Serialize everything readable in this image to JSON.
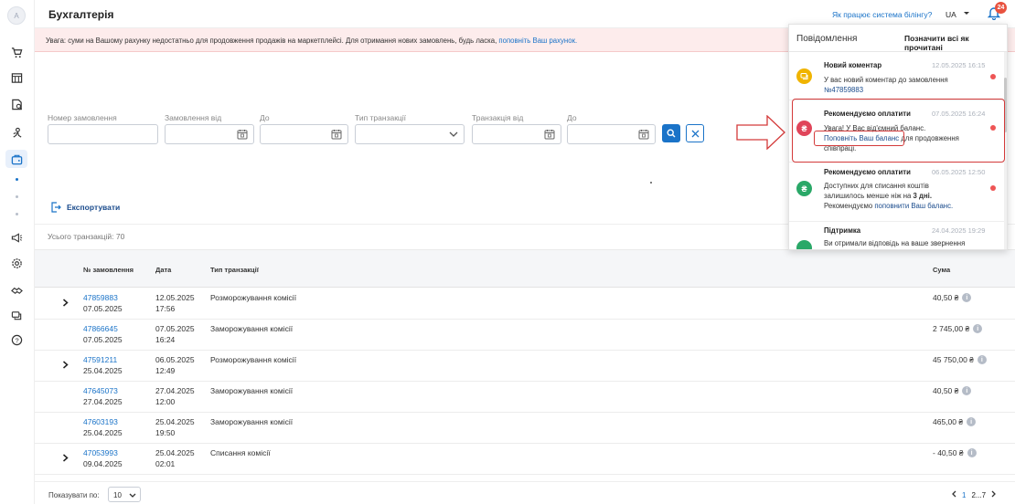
{
  "sidebar": {
    "avatar_letter": "A",
    "icons": [
      "cart-icon",
      "catalog-icon",
      "orders-icon",
      "users-icon",
      "accounting-icon",
      "megaphone-icon",
      "settings-icon",
      "handshake-icon",
      "messages-icon",
      "help-icon"
    ]
  },
  "header": {
    "title": "Бухгалтерія",
    "billing_link": "Як працює система білінгу?",
    "lang": "UA",
    "notif_count": "24"
  },
  "alert": {
    "text": "Увага: суми на Вашому рахунку недостатньо для продовження продажів на маркетплейсі. Для отримання нових замовлень, будь ласка, ",
    "link": "поповніть Ваш рахунок."
  },
  "filters": {
    "order_number": "Номер замовлення",
    "order_from": "Замовлення від",
    "order_to": "До",
    "tx_type": "Тип транзакції",
    "tx_from": "Транзакція від",
    "tx_to": "До"
  },
  "actions": {
    "export": "Експортувати"
  },
  "total": "Усього транзакцій: 70",
  "table": {
    "columns": {
      "order": "№ замовлення",
      "date": "Дата",
      "type": "Тип транзакції",
      "sum": "Сума"
    },
    "rows": [
      {
        "order": "47859883",
        "order_date": "07.05.2025",
        "date": "12.05.2025",
        "time": "17:56",
        "type": "Розморожування комісії",
        "sum": "40,50 ₴",
        "expandable": true
      },
      {
        "order": "47866645",
        "order_date": "07.05.2025",
        "date": "07.05.2025",
        "time": "16:24",
        "type": "Заморожування комісії",
        "sum": "2 745,00 ₴",
        "expandable": false
      },
      {
        "order": "47591211",
        "order_date": "25.04.2025",
        "date": "06.05.2025",
        "time": "12:49",
        "type": "Розморожування комісії",
        "sum": "45 750,00 ₴",
        "expandable": true
      },
      {
        "order": "47645073",
        "order_date": "27.04.2025",
        "date": "27.04.2025",
        "time": "12:00",
        "type": "Заморожування комісії",
        "sum": "40,50 ₴",
        "expandable": false
      },
      {
        "order": "47603193",
        "order_date": "25.04.2025",
        "date": "25.04.2025",
        "time": "19:50",
        "type": "Заморожування комісії",
        "sum": "465,00 ₴",
        "expandable": false
      },
      {
        "order": "47053993",
        "order_date": "09.04.2025",
        "date": "25.04.2025",
        "time": "02:01",
        "type": "Списання комісії",
        "sum": "- 40,50 ₴",
        "expandable": true
      }
    ]
  },
  "footer": {
    "per_page_label": "Показувати по:",
    "per_page_value": "10",
    "page_current": "1",
    "page_rest": "2...7"
  },
  "notifications": {
    "title": "Повідомлення",
    "mark_all": "Позначити всі як прочитані",
    "items": [
      {
        "title": "Новий коментар",
        "time": "12.05.2025 16:15",
        "text": "У вас новий коментар до замовлення",
        "link": "№47859883",
        "color": "#f0b400"
      },
      {
        "title": "Рекомендуємо оплатити",
        "time": "07.05.2025 16:24",
        "text1": "Увага! У Вас від'ємний баланс.",
        "link": "Поповніть Ваш баланс",
        "text2": " для продовження співпраці.",
        "color": "#e0455a"
      },
      {
        "title": "Рекомендуємо оплатити",
        "time": "06.05.2025 12:50",
        "text1": "Доступних для списання коштів залишилось менше ніж на ",
        "bold": "3 дні.",
        "text2": " Рекомендуємо ",
        "link": "поповнити Ваш баланс.",
        "color": "#2aa868"
      },
      {
        "title": "Підтримка",
        "time": "24.04.2025 19:29",
        "text": "Ви отримали відповідь на ваше звернення",
        "color": "#2aa868"
      }
    ]
  }
}
